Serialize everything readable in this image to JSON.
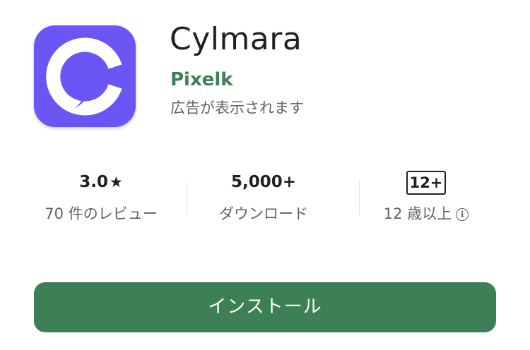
{
  "app": {
    "name": "Cylmara",
    "developer": "Pixelk",
    "ads_note": "広告が表示されます",
    "icon_name": "chat-c-logo-icon",
    "icon_bg_color": "#6c55f5"
  },
  "stats": {
    "rating": {
      "value": "3.0",
      "star": "★",
      "label": "70 件のレビュー"
    },
    "downloads": {
      "value": "5,000+",
      "label": "ダウンロード"
    },
    "age": {
      "badge": "12+",
      "label": "12 歳以上",
      "info_icon": "info-icon"
    }
  },
  "install": {
    "label": "インストール",
    "color": "#3d8055"
  },
  "colors": {
    "developer": "#3d8055",
    "primary_text": "#202124",
    "secondary_text": "#5f6368"
  }
}
